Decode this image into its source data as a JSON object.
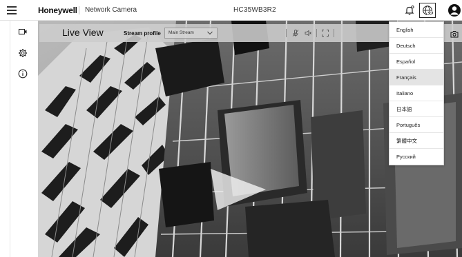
{
  "header": {
    "brand": "Honeywell",
    "product": "Network Camera",
    "model": "HC35WB3R2"
  },
  "toolbar": {
    "title": "Live View",
    "stream_profile_label": "Stream profile",
    "stream_profile_value": "Main Stream"
  },
  "language_menu": {
    "selected": "Français",
    "items": [
      {
        "label": "English"
      },
      {
        "label": "Deutsch"
      },
      {
        "label": "Español"
      },
      {
        "label": "Français"
      },
      {
        "label": "Italiano"
      },
      {
        "label": "日本語"
      },
      {
        "label": "Português"
      },
      {
        "label": "繁體中文"
      },
      {
        "label": "Русский"
      }
    ]
  },
  "icons": {
    "menu": "hamburger-menu-icon",
    "notifications": "bell-icon",
    "language": "globe-language-icon",
    "user": "user-avatar-icon",
    "live_view": "video-camera-icon",
    "settings": "gear-icon",
    "info": "info-icon",
    "microphone": "microphone-icon",
    "speaker": "speaker-icon",
    "fullscreen": "fullscreen-icon",
    "snapshot": "camera-snapshot-icon"
  },
  "colors": {
    "selected_item_bg": "#e4e4e4",
    "toolbar_bg": "#cdcdcd"
  }
}
